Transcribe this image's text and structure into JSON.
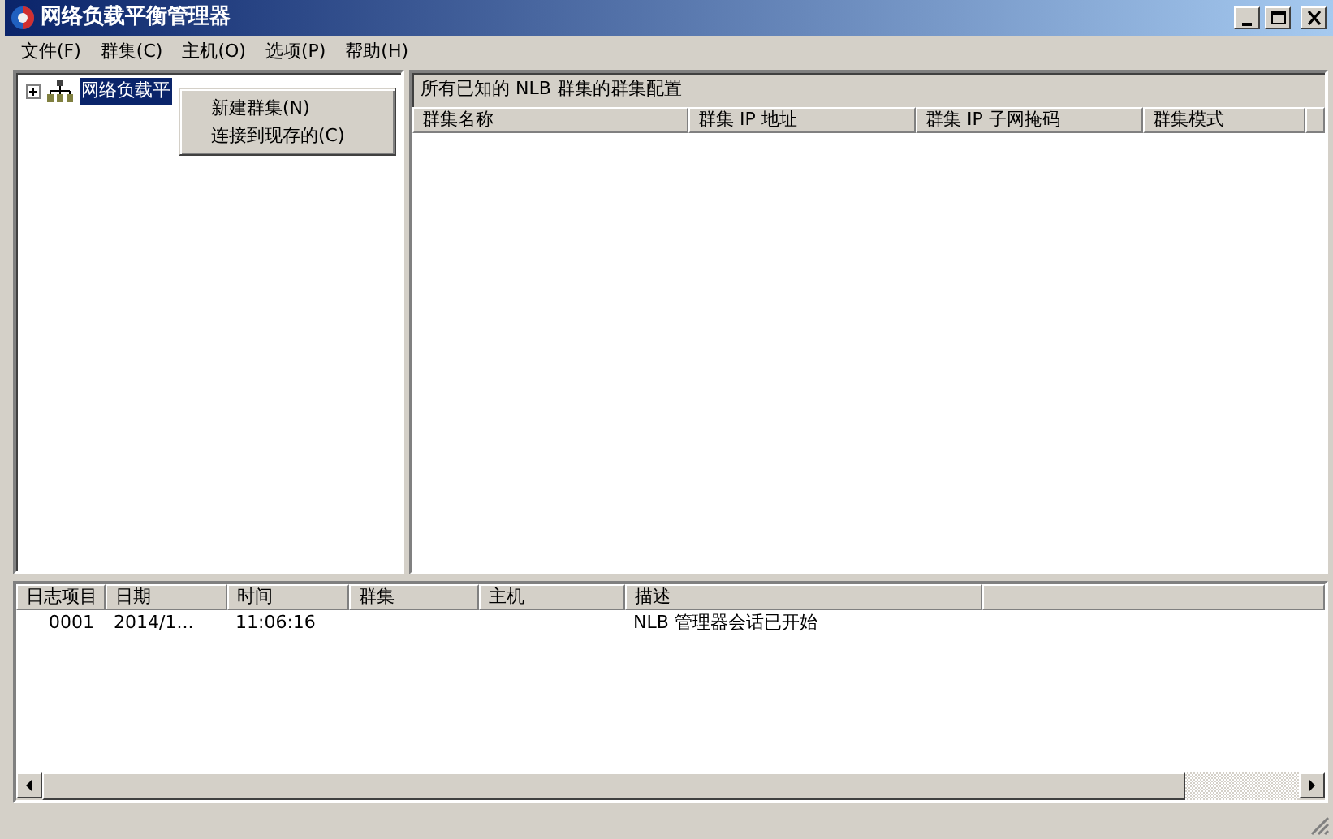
{
  "window": {
    "title": "网络负载平衡管理器"
  },
  "menu_bar": [
    "文件(F)",
    "群集(C)",
    "主机(O)",
    "选项(P)",
    "帮助(H)"
  ],
  "tree": [
    {
      "label": "网络负载平",
      "expanded": false,
      "selected": true
    }
  ],
  "context_menu": [
    "新建群集(N)",
    "连接到现存的(C)"
  ],
  "cluster_panel": {
    "heading": "所有已知的 NLB 群集的群集配置",
    "columns": [
      "群集名称",
      "群集 IP 地址",
      "群集 IP 子网掩码",
      "群集模式"
    ]
  },
  "log": {
    "columns": [
      "日志项目",
      "日期",
      "时间",
      "群集",
      "主机",
      "描述"
    ],
    "rows": [
      [
        "0001",
        "2014/1...",
        "11:06:16",
        "",
        "",
        "NLB 管理器会话已开始"
      ]
    ]
  }
}
